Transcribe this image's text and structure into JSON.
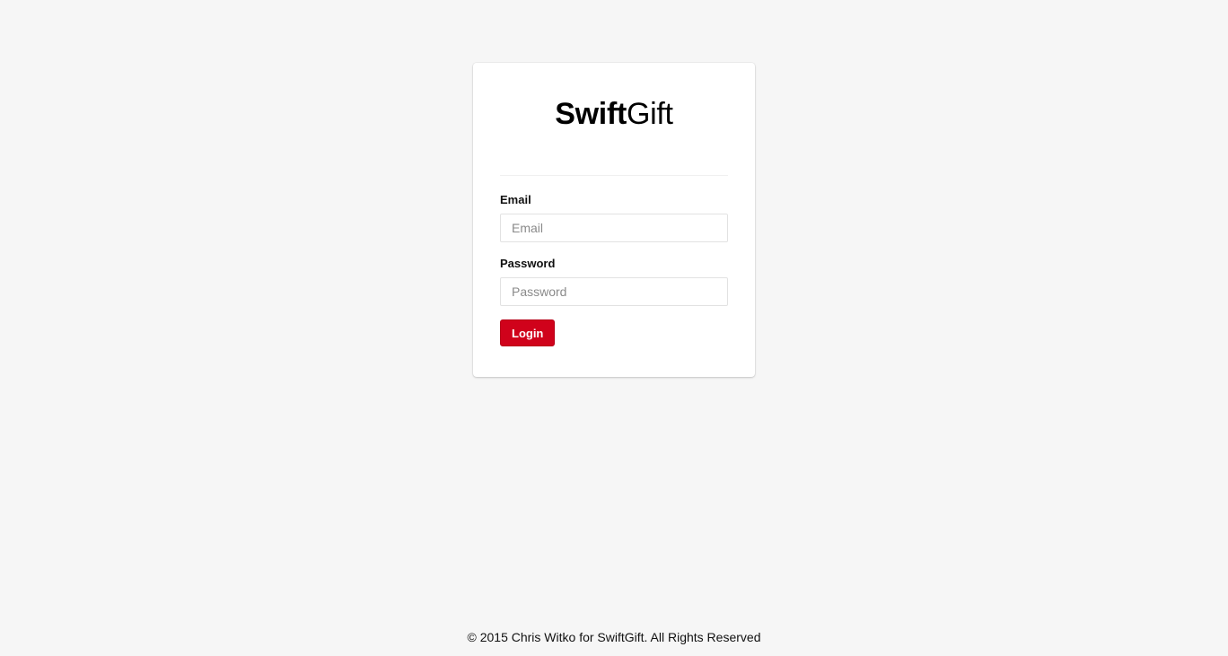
{
  "brand": {
    "bold": "Swift",
    "light": "Gift"
  },
  "form": {
    "email_label": "Email",
    "email_placeholder": "Email",
    "email_value": "",
    "password_label": "Password",
    "password_placeholder": "Password",
    "password_value": "",
    "login_label": "Login"
  },
  "footer": {
    "text": "© 2015 Chris Witko for SwiftGift. All Rights Reserved"
  },
  "colors": {
    "background": "#f6f6f6",
    "card": "#ffffff",
    "accent": "#d0021b"
  }
}
